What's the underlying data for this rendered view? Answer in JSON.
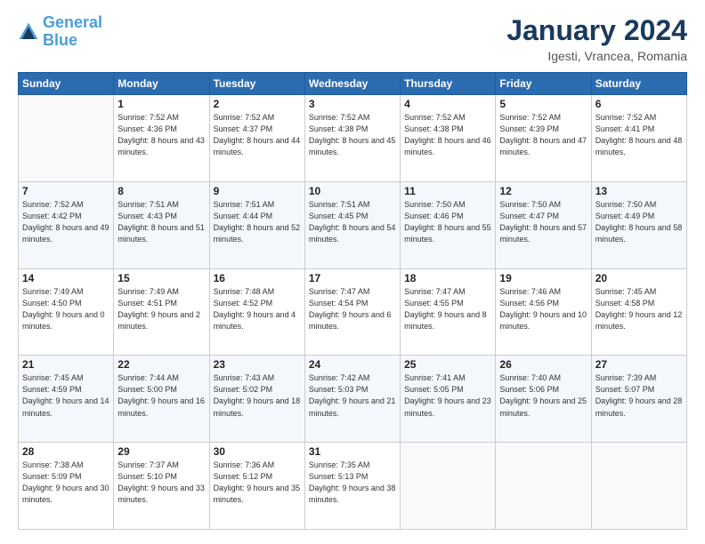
{
  "logo": {
    "line1": "General",
    "line2": "Blue"
  },
  "title": "January 2024",
  "subtitle": "Igesti, Vrancea, Romania",
  "days_header": [
    "Sunday",
    "Monday",
    "Tuesday",
    "Wednesday",
    "Thursday",
    "Friday",
    "Saturday"
  ],
  "weeks": [
    [
      {
        "day": "",
        "sunrise": "",
        "sunset": "",
        "daylight": ""
      },
      {
        "day": "1",
        "sunrise": "Sunrise: 7:52 AM",
        "sunset": "Sunset: 4:36 PM",
        "daylight": "Daylight: 8 hours and 43 minutes."
      },
      {
        "day": "2",
        "sunrise": "Sunrise: 7:52 AM",
        "sunset": "Sunset: 4:37 PM",
        "daylight": "Daylight: 8 hours and 44 minutes."
      },
      {
        "day": "3",
        "sunrise": "Sunrise: 7:52 AM",
        "sunset": "Sunset: 4:38 PM",
        "daylight": "Daylight: 8 hours and 45 minutes."
      },
      {
        "day": "4",
        "sunrise": "Sunrise: 7:52 AM",
        "sunset": "Sunset: 4:38 PM",
        "daylight": "Daylight: 8 hours and 46 minutes."
      },
      {
        "day": "5",
        "sunrise": "Sunrise: 7:52 AM",
        "sunset": "Sunset: 4:39 PM",
        "daylight": "Daylight: 8 hours and 47 minutes."
      },
      {
        "day": "6",
        "sunrise": "Sunrise: 7:52 AM",
        "sunset": "Sunset: 4:41 PM",
        "daylight": "Daylight: 8 hours and 48 minutes."
      }
    ],
    [
      {
        "day": "7",
        "sunrise": "Sunrise: 7:52 AM",
        "sunset": "Sunset: 4:42 PM",
        "daylight": "Daylight: 8 hours and 49 minutes."
      },
      {
        "day": "8",
        "sunrise": "Sunrise: 7:51 AM",
        "sunset": "Sunset: 4:43 PM",
        "daylight": "Daylight: 8 hours and 51 minutes."
      },
      {
        "day": "9",
        "sunrise": "Sunrise: 7:51 AM",
        "sunset": "Sunset: 4:44 PM",
        "daylight": "Daylight: 8 hours and 52 minutes."
      },
      {
        "day": "10",
        "sunrise": "Sunrise: 7:51 AM",
        "sunset": "Sunset: 4:45 PM",
        "daylight": "Daylight: 8 hours and 54 minutes."
      },
      {
        "day": "11",
        "sunrise": "Sunrise: 7:50 AM",
        "sunset": "Sunset: 4:46 PM",
        "daylight": "Daylight: 8 hours and 55 minutes."
      },
      {
        "day": "12",
        "sunrise": "Sunrise: 7:50 AM",
        "sunset": "Sunset: 4:47 PM",
        "daylight": "Daylight: 8 hours and 57 minutes."
      },
      {
        "day": "13",
        "sunrise": "Sunrise: 7:50 AM",
        "sunset": "Sunset: 4:49 PM",
        "daylight": "Daylight: 8 hours and 58 minutes."
      }
    ],
    [
      {
        "day": "14",
        "sunrise": "Sunrise: 7:49 AM",
        "sunset": "Sunset: 4:50 PM",
        "daylight": "Daylight: 9 hours and 0 minutes."
      },
      {
        "day": "15",
        "sunrise": "Sunrise: 7:49 AM",
        "sunset": "Sunset: 4:51 PM",
        "daylight": "Daylight: 9 hours and 2 minutes."
      },
      {
        "day": "16",
        "sunrise": "Sunrise: 7:48 AM",
        "sunset": "Sunset: 4:52 PM",
        "daylight": "Daylight: 9 hours and 4 minutes."
      },
      {
        "day": "17",
        "sunrise": "Sunrise: 7:47 AM",
        "sunset": "Sunset: 4:54 PM",
        "daylight": "Daylight: 9 hours and 6 minutes."
      },
      {
        "day": "18",
        "sunrise": "Sunrise: 7:47 AM",
        "sunset": "Sunset: 4:55 PM",
        "daylight": "Daylight: 9 hours and 8 minutes."
      },
      {
        "day": "19",
        "sunrise": "Sunrise: 7:46 AM",
        "sunset": "Sunset: 4:56 PM",
        "daylight": "Daylight: 9 hours and 10 minutes."
      },
      {
        "day": "20",
        "sunrise": "Sunrise: 7:45 AM",
        "sunset": "Sunset: 4:58 PM",
        "daylight": "Daylight: 9 hours and 12 minutes."
      }
    ],
    [
      {
        "day": "21",
        "sunrise": "Sunrise: 7:45 AM",
        "sunset": "Sunset: 4:59 PM",
        "daylight": "Daylight: 9 hours and 14 minutes."
      },
      {
        "day": "22",
        "sunrise": "Sunrise: 7:44 AM",
        "sunset": "Sunset: 5:00 PM",
        "daylight": "Daylight: 9 hours and 16 minutes."
      },
      {
        "day": "23",
        "sunrise": "Sunrise: 7:43 AM",
        "sunset": "Sunset: 5:02 PM",
        "daylight": "Daylight: 9 hours and 18 minutes."
      },
      {
        "day": "24",
        "sunrise": "Sunrise: 7:42 AM",
        "sunset": "Sunset: 5:03 PM",
        "daylight": "Daylight: 9 hours and 21 minutes."
      },
      {
        "day": "25",
        "sunrise": "Sunrise: 7:41 AM",
        "sunset": "Sunset: 5:05 PM",
        "daylight": "Daylight: 9 hours and 23 minutes."
      },
      {
        "day": "26",
        "sunrise": "Sunrise: 7:40 AM",
        "sunset": "Sunset: 5:06 PM",
        "daylight": "Daylight: 9 hours and 25 minutes."
      },
      {
        "day": "27",
        "sunrise": "Sunrise: 7:39 AM",
        "sunset": "Sunset: 5:07 PM",
        "daylight": "Daylight: 9 hours and 28 minutes."
      }
    ],
    [
      {
        "day": "28",
        "sunrise": "Sunrise: 7:38 AM",
        "sunset": "Sunset: 5:09 PM",
        "daylight": "Daylight: 9 hours and 30 minutes."
      },
      {
        "day": "29",
        "sunrise": "Sunrise: 7:37 AM",
        "sunset": "Sunset: 5:10 PM",
        "daylight": "Daylight: 9 hours and 33 minutes."
      },
      {
        "day": "30",
        "sunrise": "Sunrise: 7:36 AM",
        "sunset": "Sunset: 5:12 PM",
        "daylight": "Daylight: 9 hours and 35 minutes."
      },
      {
        "day": "31",
        "sunrise": "Sunrise: 7:35 AM",
        "sunset": "Sunset: 5:13 PM",
        "daylight": "Daylight: 9 hours and 38 minutes."
      },
      {
        "day": "",
        "sunrise": "",
        "sunset": "",
        "daylight": ""
      },
      {
        "day": "",
        "sunrise": "",
        "sunset": "",
        "daylight": ""
      },
      {
        "day": "",
        "sunrise": "",
        "sunset": "",
        "daylight": ""
      }
    ]
  ]
}
